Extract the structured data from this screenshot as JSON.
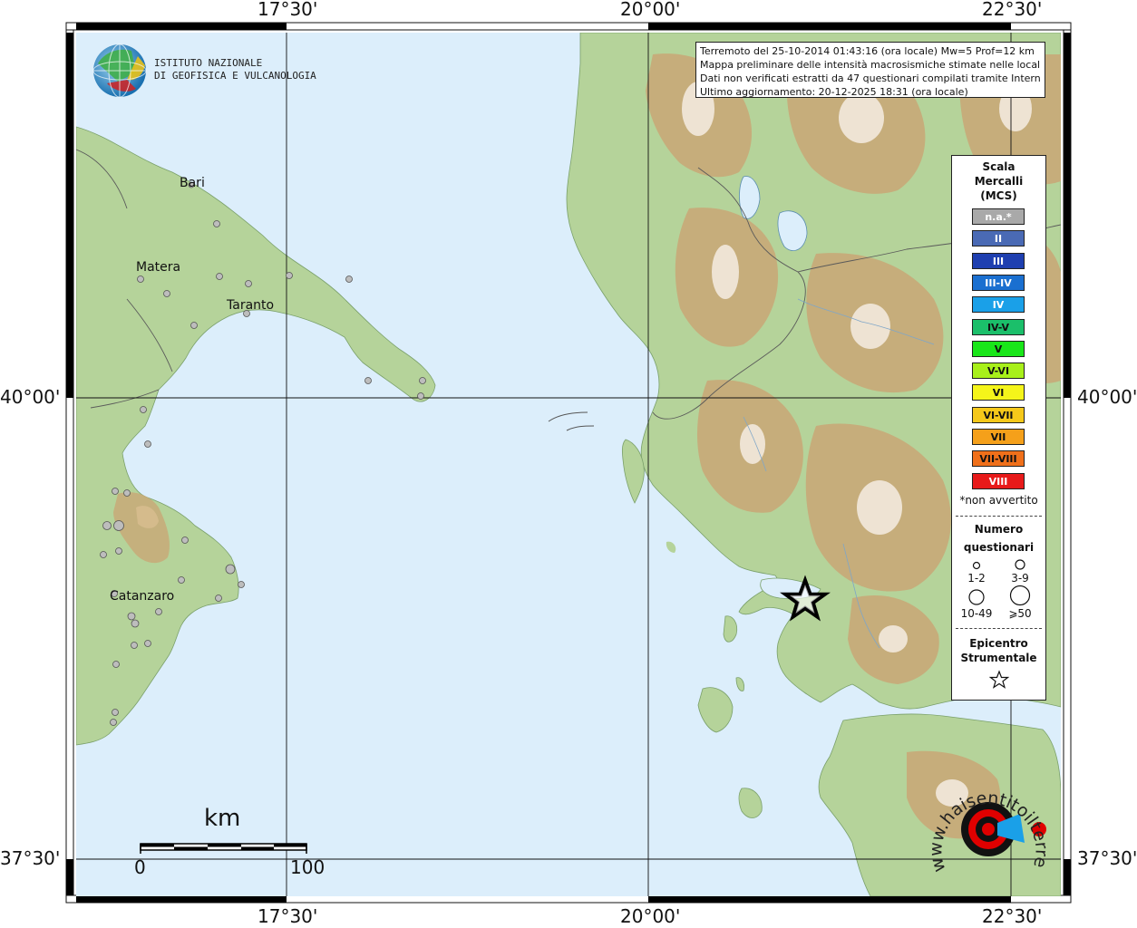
{
  "ticks": {
    "top": [
      "17°30'",
      "20°00'",
      "22°30'"
    ],
    "bottom": [
      "17°30'",
      "20°00'",
      "22°30'"
    ],
    "left": [
      "40°00'",
      "37°30'"
    ],
    "right": [
      "40°00'",
      "37°30'"
    ]
  },
  "logo": {
    "line1": "ISTITUTO NAZIONALE",
    "line2": "DI GEOFISICA E VULCANOLOGIA"
  },
  "info": {
    "line1": "Terremoto del 25-10-2014 01:43:16 (ora locale) Mw=5 Prof=12 km",
    "line2": "Mappa preliminare delle intensità macrosismiche stimate nelle località",
    "line3": "Dati non verificati estratti da 47 questionari compilati tramite Internet.",
    "line4": "Ultimo aggiornamento: 20-12-2025 18:31 (ora locale)"
  },
  "cities": {
    "bari": "Bari",
    "matera": "Matera",
    "taranto": "Taranto",
    "catanzaro": "Catanzaro"
  },
  "legend": {
    "title1": "Scala",
    "title2": "Mercalli",
    "title3": "(MCS)",
    "classes": [
      {
        "label": "n.a.*",
        "color": "#a9a9a9",
        "text": "#ffffff"
      },
      {
        "label": "II",
        "color": "#4a6ab5",
        "text": "#ffffff"
      },
      {
        "label": "III",
        "color": "#1e3fb0",
        "text": "#ffffff"
      },
      {
        "label": "III-IV",
        "color": "#1a6fd0",
        "text": "#ffffff"
      },
      {
        "label": "IV",
        "color": "#1aa0e8",
        "text": "#ffffff"
      },
      {
        "label": "IV-V",
        "color": "#1bbf6a",
        "text": "#111111"
      },
      {
        "label": "V",
        "color": "#19e619",
        "text": "#111111"
      },
      {
        "label": "V-VI",
        "color": "#a8f01a",
        "text": "#111111"
      },
      {
        "label": "VI",
        "color": "#f5f51a",
        "text": "#111111"
      },
      {
        "label": "VI-VII",
        "color": "#f5c81a",
        "text": "#111111"
      },
      {
        "label": "VII",
        "color": "#f5a01a",
        "text": "#111111"
      },
      {
        "label": "VII-VIII",
        "color": "#f0701a",
        "text": "#111111"
      },
      {
        "label": "VIII",
        "color": "#e81a1a",
        "text": "#ffffff"
      }
    ],
    "note": "*non avvertito",
    "count_title1": "Numero",
    "count_title2": "questionari",
    "counts": [
      "1-2",
      "3-9",
      "10-49",
      "⩾50"
    ],
    "epi_title1": "Epicentro",
    "epi_title2": "Strumentale"
  },
  "scale_bar": {
    "unit": "km",
    "start": "0",
    "end": "100"
  },
  "watermark": {
    "text": "www.haisentitoilterremoto.it"
  },
  "colors": {
    "sea": "#dceefb",
    "land": "#b5d39a",
    "mountain": "#c8a978",
    "peak": "#f2e9dd",
    "station": "#bdbdbd",
    "border": "#111111"
  }
}
